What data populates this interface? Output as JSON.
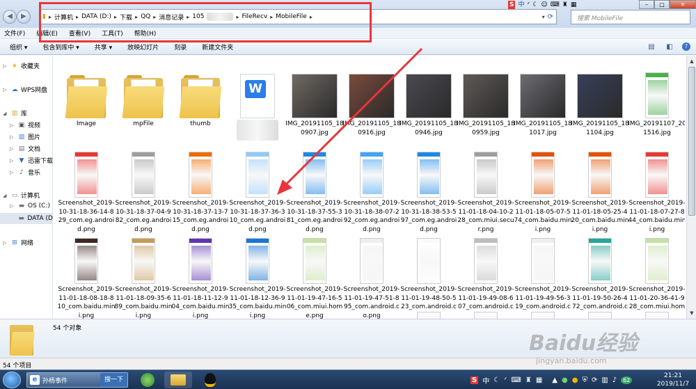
{
  "breadcrumb": [
    "计算机",
    "DATA (D:)",
    "下载",
    "QQ",
    "消息记录",
    "105",
    "FileRecv",
    "MobileFile"
  ],
  "search": {
    "placeholder": "搜索 MobileFile"
  },
  "menu": [
    "文件(F)",
    "编辑(E)",
    "查看(V)",
    "工具(T)",
    "帮助(H)"
  ],
  "toolbar": [
    "组织 ▾",
    "包含到库中 ▾",
    "共享 ▾",
    "放映幻灯片",
    "刻录",
    "新建文件夹"
  ],
  "sidebar": {
    "favorites": "收藏夹",
    "wps": "WPS网盘",
    "library": "库",
    "videos": "视频",
    "pictures": "图片",
    "documents": "文档",
    "xunlei": "迅雷下载",
    "music": "音乐",
    "computer": "计算机",
    "osc": "OS (C:)",
    "datad": "DATA (D",
    "network": "网络"
  },
  "rows": [
    [
      {
        "name": "Image",
        "kind": "folder"
      },
      {
        "name": "mpFile",
        "kind": "folder"
      },
      {
        "name": "thumb",
        "kind": "folder"
      },
      {
        "name": "",
        "kind": "word"
      },
      {
        "name": "IMG_20191105_180907.jpg",
        "kind": "photo",
        "color": "#6f6a63"
      },
      {
        "name": "IMG_20191105_180916.jpg",
        "kind": "photo",
        "color": "#7a4b3c"
      },
      {
        "name": "IMG_20191105_180946.jpg",
        "kind": "photo",
        "color": "#4a4a52"
      },
      {
        "name": "IMG_20191105_180959.jpg",
        "kind": "photo",
        "color": "#5f5a57"
      },
      {
        "name": "IMG_20191105_181017.jpg",
        "kind": "photo",
        "color": "#6c6c72"
      },
      {
        "name": "IMG_20191105_181104.jpg",
        "kind": "photo",
        "color": "#38405a"
      },
      {
        "name": "IMG_20191107_201516.jpg",
        "kind": "shot",
        "color": "#4caf50"
      }
    ],
    [
      {
        "name": "Screenshot_2019-10-31-18-36-14-829_com.eg.android.png",
        "kind": "shot",
        "color": "#e53935"
      },
      {
        "name": "Screenshot_2019-10-31-18-37-04-982_com.eg.android.png",
        "kind": "shot",
        "color": "#9e9e9e"
      },
      {
        "name": "Screenshot_2019-10-31-18-37-13-715_com.eg.android.png",
        "kind": "shot",
        "color": "#ef6c00"
      },
      {
        "name": "Screenshot_2019-10-31-18-37-36-310_com.eg.android.png",
        "kind": "shot",
        "color": "#90caf9"
      },
      {
        "name": "Screenshot_2019-10-31-18-37-55-381_com.eg.android.png",
        "kind": "shot",
        "color": "#1e88e5"
      },
      {
        "name": "Screenshot_2019-10-31-18-38-07-292_com.eg.android.png",
        "kind": "shot",
        "color": "#42a5f5"
      },
      {
        "name": "Screenshot_2019-10-31-18-38-53-597_com.eg.android.png",
        "kind": "shot",
        "color": "#1e88e5"
      },
      {
        "name": "Screenshot_2019-11-01-18-04-10-228_com.miui.secur.png",
        "kind": "shot",
        "color": "#9e9e9e"
      },
      {
        "name": "Screenshot_2019-11-01-18-05-07-574_com.baidu.mini.png",
        "kind": "shot",
        "color": "#e65100"
      },
      {
        "name": "Screenshot_2019-11-01-18-05-25-420_com.baidu.mini.png",
        "kind": "shot",
        "color": "#e65100"
      },
      {
        "name": "Screenshot_2019-11-01-18-07-27-844_com.baidu.mini.png",
        "kind": "shot",
        "color": "#e53935"
      }
    ],
    [
      {
        "name": "Screenshot_2019-11-01-18-08-18-810_com.baidu.mini.png",
        "kind": "shot",
        "color": "#3e2723"
      },
      {
        "name": "Screenshot_2019-11-01-18-09-35-689_com.baidu.mini.png",
        "kind": "shot",
        "color": "#c69c5a"
      },
      {
        "name": "Screenshot_2019-11-01-18-11-12-904_com.baidu.mini.png",
        "kind": "shot",
        "color": "#5e35b1"
      },
      {
        "name": "Screenshot_2019-11-01-18-12-36-935_com.baidu.mini.png",
        "kind": "shot",
        "color": "#1976d2"
      },
      {
        "name": "Screenshot_2019-11-01-19-47-16-506_com.miui.home.png",
        "kind": "shot",
        "color": "#c5e1a5"
      },
      {
        "name": "Screenshot_2019-11-01-19-47-51-895_com.android.co.png",
        "kind": "shot",
        "color": "#eeeeee"
      },
      {
        "name": "Screenshot_2019-11-01-19-48-50-523_com.android.co.png",
        "kind": "shot",
        "color": "#fafafa"
      },
      {
        "name": "Screenshot_2019-11-01-19-49-08-607_com.android.co.png",
        "kind": "shot",
        "color": "#bdbdbd"
      },
      {
        "name": "Screenshot_2019-11-01-19-49-56-319_com.android.co.png",
        "kind": "shot",
        "color": "#eeeeee"
      },
      {
        "name": "Screenshot_2019-11-01-19-50-26-472_com.android.co.png",
        "kind": "shot",
        "color": "#26a69a"
      },
      {
        "name": "Screenshot_2019-11-01-20-36-41-928_com.miui.home.png",
        "kind": "shot",
        "color": "#c5e1a5"
      }
    ]
  ],
  "details": {
    "count": "54 个对象"
  },
  "status": {
    "items": "54 个项目"
  },
  "watermark": {
    "logo": "Baidu经验",
    "url": "jingyan.baidu.com"
  },
  "taskbar": {
    "qq_window": "孙杨事件",
    "qq_button": "搜一下"
  },
  "clock": {
    "time": "21:21",
    "date": "2019/11/7"
  },
  "tray_badge": "62"
}
